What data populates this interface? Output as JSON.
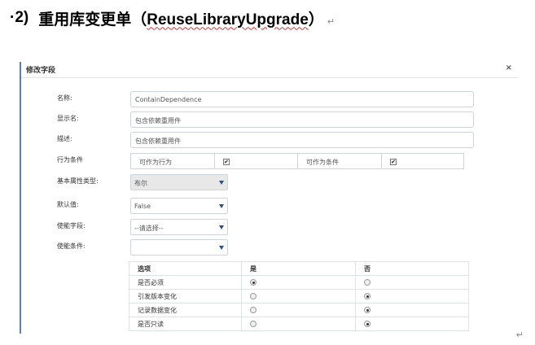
{
  "doc": {
    "heading_number": "·2)",
    "heading_title": "重用库变更单（",
    "heading_english": "ReuseLibraryUpgrade",
    "heading_close": "）",
    "paragraph_mark": "↵"
  },
  "dialog": {
    "title": "修改字段",
    "close_label": "×"
  },
  "form": {
    "name": {
      "label": "名称:",
      "value": "ContainDependence"
    },
    "display_name": {
      "label": "显示名:",
      "value": "包含依赖重用件"
    },
    "description": {
      "label": "描述:",
      "value": "包含依赖重用件"
    },
    "behavior": {
      "label": "行为条件",
      "as_action_label": "可作为行为",
      "as_action_checked": true,
      "as_condition_label": "可作为条件",
      "as_condition_checked": true
    },
    "base_type": {
      "label": "基本属性类型:",
      "value": "布尔"
    },
    "default_value": {
      "label": "默认值:",
      "value": "False"
    },
    "enable_field": {
      "label": "使能字段:",
      "value": "--请选择--"
    },
    "enable_condition": {
      "label": "使能条件:",
      "value": ""
    }
  },
  "options_table": {
    "headers": [
      "选项",
      "是",
      "否"
    ],
    "rows": [
      {
        "label": "是否必须",
        "yes": true,
        "no": false
      },
      {
        "label": "引发版本变化",
        "yes": false,
        "no": true
      },
      {
        "label": "记录数据变化",
        "yes": false,
        "no": true
      },
      {
        "label": "是否只读",
        "yes": false,
        "no": true
      }
    ]
  },
  "icons": {
    "checkmark": "✔",
    "caret": "chevron-down-icon"
  }
}
